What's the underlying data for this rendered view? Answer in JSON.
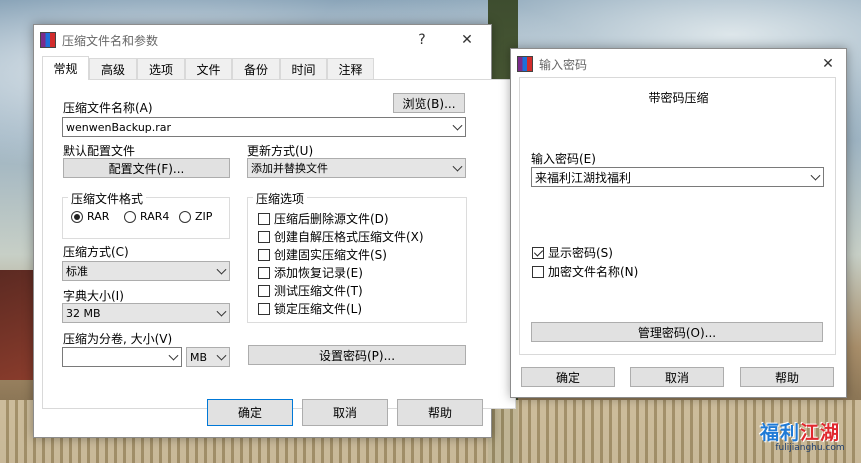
{
  "main_dialog": {
    "title": "压缩文件名和参数",
    "help_glyph": "?",
    "close_glyph": "✕",
    "tabs": [
      "常规",
      "高级",
      "选项",
      "文件",
      "备份",
      "时间",
      "注释"
    ],
    "archive_name_label": "压缩文件名称(A)",
    "browse_button": "浏览(B)...",
    "archive_name_value": "wenwenBackup.rar",
    "default_profile_label": "默认配置文件",
    "profile_button": "配置文件(F)...",
    "update_mode_label": "更新方式(U)",
    "update_mode_value": "添加并替换文件",
    "archive_format_label": "压缩文件格式",
    "formats": [
      {
        "label": "RAR",
        "selected": true
      },
      {
        "label": "RAR4",
        "selected": false
      },
      {
        "label": "ZIP",
        "selected": false
      }
    ],
    "compression_method_label": "压缩方式(C)",
    "compression_method_value": "标准",
    "dictionary_size_label": "字典大小(I)",
    "dictionary_size_value": "32 MB",
    "split_volume_label": "压缩为分卷, 大小(V)",
    "split_size_value": "",
    "split_unit_value": "MB",
    "options_label": "压缩选项",
    "options": [
      {
        "label": "压缩后删除源文件(D)",
        "checked": false
      },
      {
        "label": "创建自解压格式压缩文件(X)",
        "checked": false
      },
      {
        "label": "创建固实压缩文件(S)",
        "checked": false
      },
      {
        "label": "添加恢复记录(E)",
        "checked": false
      },
      {
        "label": "测试压缩文件(T)",
        "checked": false
      },
      {
        "label": "锁定压缩文件(L)",
        "checked": false
      }
    ],
    "set_password_button": "设置密码(P)...",
    "ok_button": "确定",
    "cancel_button": "取消",
    "help_button": "帮助"
  },
  "password_dialog": {
    "title": "输入密码",
    "close_glyph": "✕",
    "heading": "带密码压缩",
    "password_label": "输入密码(E)",
    "password_value": "来福利江湖找福利",
    "show_password_label": "显示密码(S)",
    "show_password_checked": true,
    "encrypt_names_label": "加密文件名称(N)",
    "encrypt_names_checked": false,
    "manage_button": "管理密码(O)...",
    "ok_button": "确定",
    "cancel_button": "取消",
    "help_button": "帮助"
  },
  "watermark": {
    "part1": "福利",
    "part2": "江湖",
    "url": "fulijianghu.com"
  },
  "colors": {
    "focus_border": "#0078d7",
    "button_face": "#e1e1e1",
    "watermark_blue": "#1f7ad6",
    "watermark_red": "#e0282e"
  }
}
